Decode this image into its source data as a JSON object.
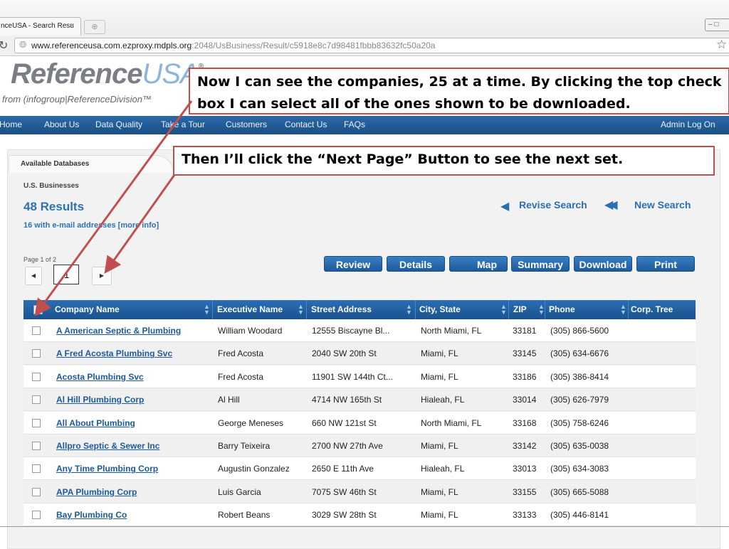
{
  "browser": {
    "tab_title": "nceUSA - Search Resu",
    "tab_close": "×",
    "new_tab_icon": "new-tab-icon",
    "window_controls": "‒ □",
    "reload_icon": "↻",
    "url_host": "www.referenceusa.com.ezproxy.mdpls.org",
    "url_path": ":2048/UsBusiness/Result/c5918e8c7d98481fbbb83632fc50a20a",
    "star_icon": "☆"
  },
  "brand": {
    "logo_main": "Reference",
    "logo_accent": "USA",
    "logo_reg": "®",
    "tagline": "from (infogroup|ReferenceDivision™"
  },
  "nav": {
    "items": [
      "Home",
      "About Us",
      "Data Quality",
      "Take a Tour",
      "Customers",
      "Contact Us",
      "FAQs"
    ],
    "admin": "Admin Log On"
  },
  "callouts": {
    "first": "Now I can see the companies, 25 at a time.  By clicking the top check box I can select all of the ones shown to be downloaded.",
    "second": "Then I’ll click the “Next Page” Button to see the next set."
  },
  "panel": {
    "db_tab": "Available Databases",
    "database": "U.S. Businesses",
    "results": "48 Results",
    "email_info": "16 with e-mail addresses [more info]",
    "revise": "Revise Search",
    "new_search": "New Search",
    "page_of": "Page 1 of 2",
    "page_value": "1",
    "prev_icon": "◀",
    "next_icon": "▶"
  },
  "actions": [
    "Review",
    "Details",
    "Map",
    "Summary",
    "Download",
    "Print"
  ],
  "table": {
    "columns": [
      "Company Name",
      "Executive Name",
      "Street Address",
      "City, State",
      "ZIP",
      "Phone",
      "Corp. Tree"
    ],
    "rows": [
      [
        "A American Septic & Plumbing",
        "William Woodard",
        "12555 Biscayne Bl...",
        "North Miami, FL",
        "33181",
        "(305) 866-5600"
      ],
      [
        "A Fred Acosta Plumbing Svc",
        "Fred Acosta",
        "2040 SW 20th St",
        "Miami, FL",
        "33145",
        "(305) 634-6676"
      ],
      [
        "Acosta Plumbing Svc",
        "Fred Acosta",
        "11901 SW 144th Ct...",
        "Miami, FL",
        "33186",
        "(305) 386-8414"
      ],
      [
        "Al Hill Plumbing Corp",
        "Al Hill",
        "4714 NW 165th St",
        "Hialeah, FL",
        "33014",
        "(305) 626-7979"
      ],
      [
        "All About Plumbing",
        "George Meneses",
        "660 NW 121st St",
        "North Miami, FL",
        "33168",
        "(305) 758-6246"
      ],
      [
        "Allpro Septic & Sewer Inc",
        "Barry Teixeira",
        "2700 NW 27th Ave",
        "Miami, FL",
        "33142",
        "(305) 635-0038"
      ],
      [
        "Any Time Plumbing Corp",
        "Augustin Gonzalez",
        "2650 E 11th Ave",
        "Hialeah, FL",
        "33013",
        "(305) 634-3083"
      ],
      [
        "APA Plumbing Corp",
        "Luis Garcia",
        "7075 SW 46th St",
        "Miami, FL",
        "33155",
        "(305) 665-5088"
      ],
      [
        "Bay Plumbing Co",
        "Robert Beans",
        "3029 SW 28th St",
        "Miami, FL",
        "33133",
        "(305) 446-8141"
      ]
    ]
  },
  "colors": {
    "nav_blue": "#1a4f86",
    "link_blue": "#2d71b5",
    "callout_border": "#c0504d"
  }
}
